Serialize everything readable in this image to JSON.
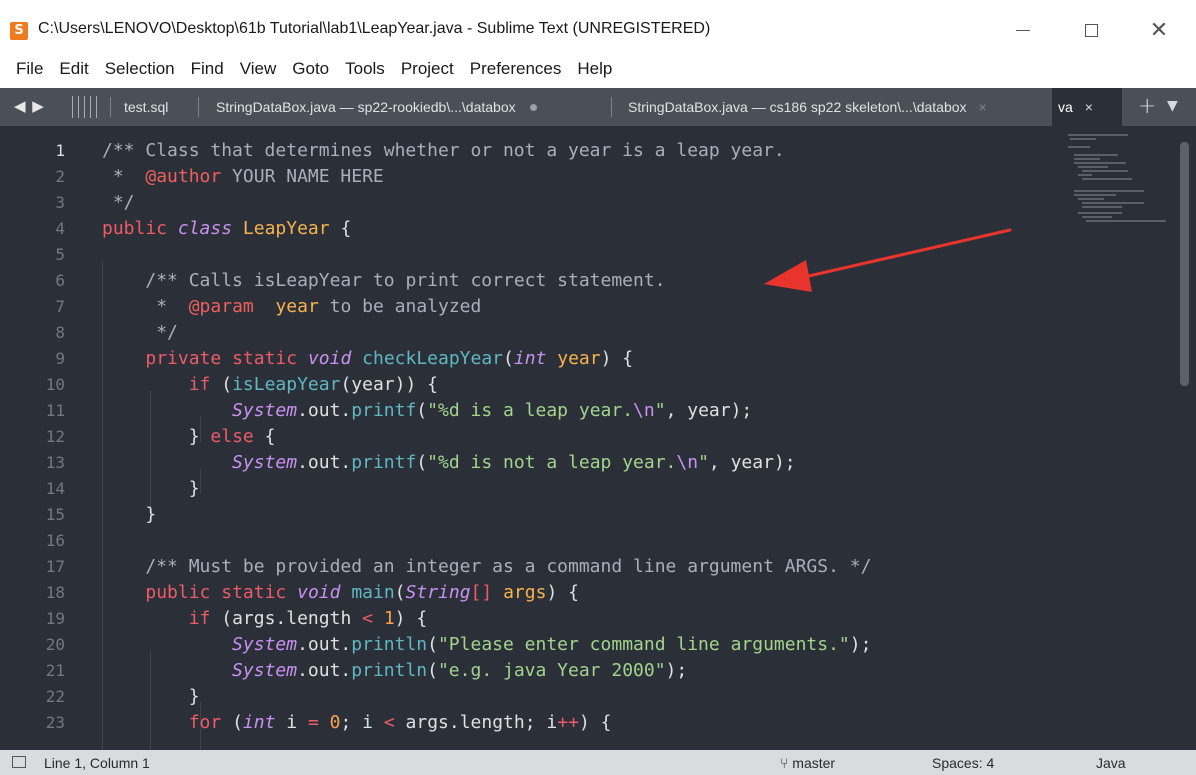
{
  "window": {
    "title": "C:\\Users\\LENOVO\\Desktop\\61b Tutorial\\lab1\\LeapYear.java - Sublime Text (UNREGISTERED)",
    "app_icon": "sublime-text-icon",
    "controls": {
      "minimize": "minimize-icon",
      "maximize": "maximize-icon",
      "close": "✕"
    }
  },
  "menu": [
    "File",
    "Edit",
    "Selection",
    "Find",
    "View",
    "Goto",
    "Tools",
    "Project",
    "Preferences",
    "Help"
  ],
  "tabbar": {
    "nav": "◀ ▶",
    "tabs": [
      {
        "label": "test.sql",
        "active": false
      },
      {
        "label": "StringDataBox.java — sp22-rookiedb\\...\\databox",
        "active": false,
        "modified": true
      },
      {
        "label": "StringDataBox.java — cs186 sp22 skeleton\\...\\databox",
        "active": false,
        "close": "×"
      },
      {
        "label": "va",
        "active": true,
        "close": "×"
      }
    ],
    "new_tab": "+",
    "dropdown": "▼"
  },
  "editor": {
    "line_numbers": [
      "1",
      "2",
      "3",
      "4",
      "5",
      "6",
      "7",
      "8",
      "9",
      "10",
      "11",
      "12",
      "13",
      "14",
      "15",
      "16",
      "17",
      "18",
      "19",
      "20",
      "21",
      "22",
      "23"
    ],
    "current_line": 1
  },
  "status": {
    "position": "Line 1, Column 1",
    "branch": "master",
    "spaces": "Spaces: 4",
    "syntax": "Java"
  },
  "colors": {
    "editor_bg": "#2b3038",
    "tabbar_bg": "#4a5058",
    "annotation_arrow": "#e8342c"
  }
}
